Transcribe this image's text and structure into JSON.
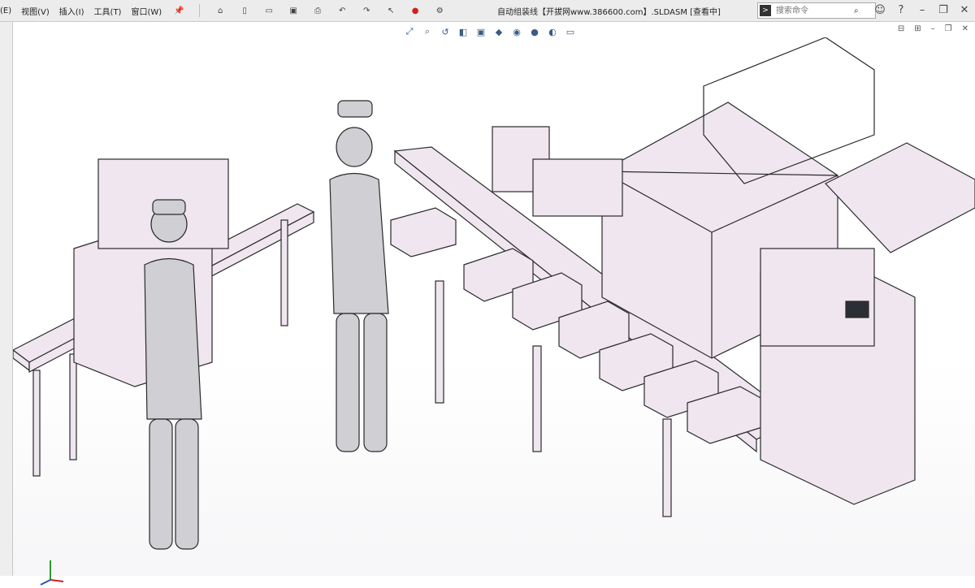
{
  "menubar": {
    "items": [
      "(E)",
      "视图(V)",
      "插入(I)",
      "工具(T)",
      "窗口(W)"
    ],
    "title": "自动组装线【开拔网www.386600.com】.SLDASM [查看中]",
    "search_placeholder": "搜索命令"
  },
  "icons": {
    "pin": "pin-icon",
    "home": "home-icon",
    "new": "new-file-icon",
    "open": "open-icon",
    "save": "save-icon",
    "print": "print-icon",
    "undo": "undo-icon",
    "redo": "redo-icon",
    "select": "select-icon",
    "rebuild": "traffic-light-icon",
    "options": "gear-icon",
    "user": "user-icon",
    "help": "help-icon",
    "restore": "restore-window-icon",
    "close": "close-icon"
  },
  "colors": {
    "part_fill": "#efe6ef",
    "part_edge": "#2a2a2a",
    "human": "#cfcfd4"
  }
}
